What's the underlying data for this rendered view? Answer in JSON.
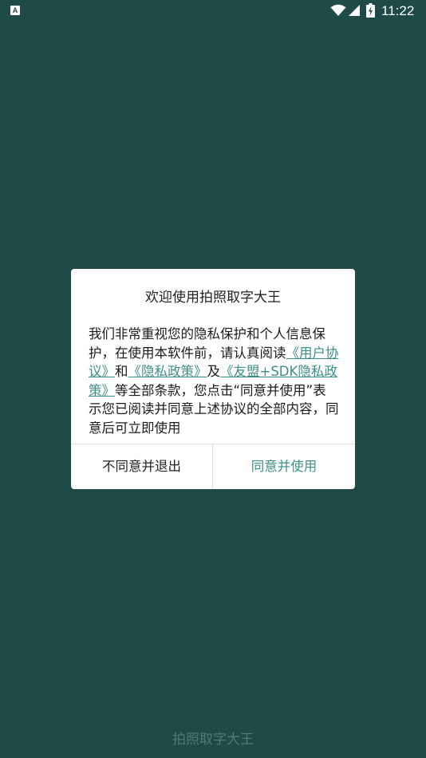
{
  "status_bar": {
    "notification_icon": "text-a-notification-icon",
    "notification_glyph": "A",
    "time": "11:22",
    "icons": [
      "wifi-icon",
      "signal-icon",
      "battery-charging-icon"
    ]
  },
  "dialog": {
    "title": "欢迎使用拍照取字大王",
    "body": {
      "text_1": "我们非常重视您的隐私保护和个人信息保护，在使用本软件前，请认真阅读",
      "link_user_agreement": "《用户协议》",
      "text_2": "和",
      "link_privacy_policy": "《隐私政策》",
      "text_3": "及",
      "link_umeng_sdk_policy": "《友盟+SDK隐私政策》",
      "text_4": "等全部条款，您点击“同意并使用”表示您已阅读并同意上述协议的全部内容，同意后可立即使用"
    },
    "decline_label": "不同意并退出",
    "agree_label": "同意并使用"
  },
  "footer": {
    "app_name": "拍照取字大王"
  },
  "colors": {
    "background": "#1e4a47",
    "accent": "#3c8f8a",
    "dialog_background": "#ffffff"
  }
}
